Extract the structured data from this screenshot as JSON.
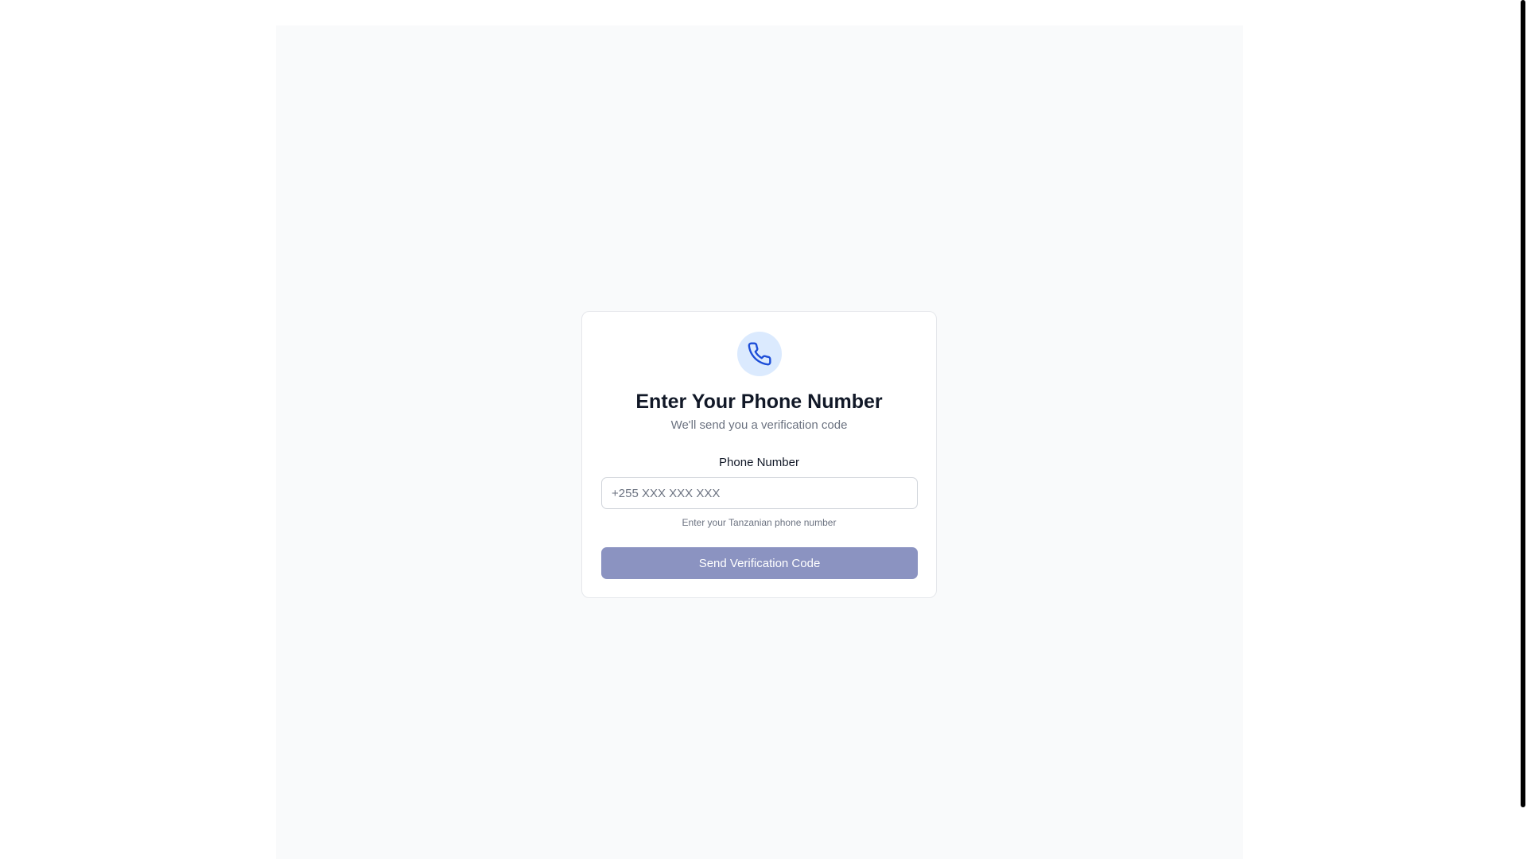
{
  "card": {
    "icon": "phone-icon",
    "title": "Enter Your Phone Number",
    "subtitle": "We'll send you a verification code",
    "field_label": "Phone Number",
    "phone_input": {
      "value": "",
      "placeholder": "+255 XXX XXX XXX"
    },
    "helper_text": "Enter your Tanzanian phone number",
    "submit_label": "Send Verification Code"
  },
  "colors": {
    "accent": "#1d4ed8",
    "icon_background": "#dbeafe",
    "button_disabled": "#8b93c1",
    "page_background": "#f9fafb"
  },
  "scrollbar": {
    "thumb_fraction": 0.94
  }
}
